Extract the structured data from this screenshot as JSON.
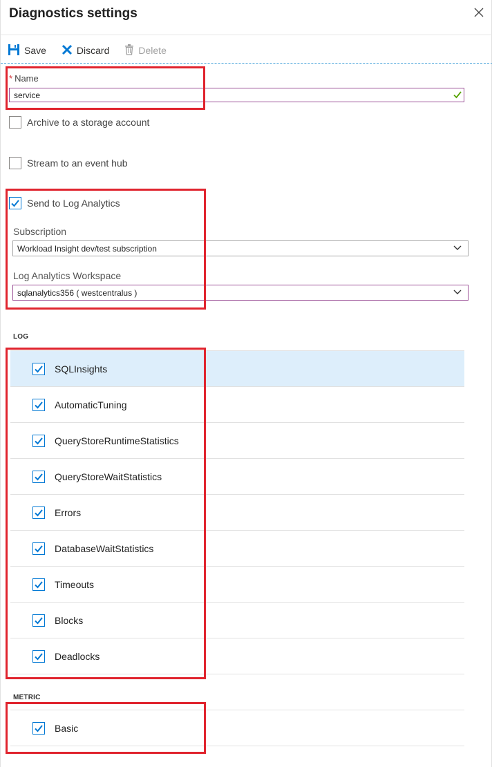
{
  "header": {
    "title": "Diagnostics settings"
  },
  "toolbar": {
    "save_label": "Save",
    "discard_label": "Discard",
    "delete_label": "Delete"
  },
  "name_field": {
    "label": "Name",
    "required_mark": "*",
    "value": "service"
  },
  "options": {
    "archive_label": "Archive to a storage account",
    "archive_checked": false,
    "stream_label": "Stream to an event hub",
    "stream_checked": false,
    "log_analytics_label": "Send to Log Analytics",
    "log_analytics_checked": true
  },
  "subscription": {
    "label": "Subscription",
    "value": "Workload Insight dev/test subscription"
  },
  "workspace": {
    "label": "Log Analytics Workspace",
    "value": "sqlanalytics356 ( westcentralus )"
  },
  "log": {
    "heading": "LOG",
    "items": [
      {
        "label": "SQLInsights",
        "checked": true,
        "selected": true
      },
      {
        "label": "AutomaticTuning",
        "checked": true
      },
      {
        "label": "QueryStoreRuntimeStatistics",
        "checked": true
      },
      {
        "label": "QueryStoreWaitStatistics",
        "checked": true
      },
      {
        "label": "Errors",
        "checked": true
      },
      {
        "label": "DatabaseWaitStatistics",
        "checked": true
      },
      {
        "label": "Timeouts",
        "checked": true
      },
      {
        "label": "Blocks",
        "checked": true
      },
      {
        "label": "Deadlocks",
        "checked": true
      }
    ]
  },
  "metric": {
    "heading": "METRIC",
    "items": [
      {
        "label": "Basic",
        "checked": true
      }
    ]
  },
  "colors": {
    "accent": "#0078d4",
    "focus_border": "#9b4f96",
    "annotation": "#e0242e",
    "valid_check": "#57a300",
    "selected_row": "#ddeefb"
  }
}
